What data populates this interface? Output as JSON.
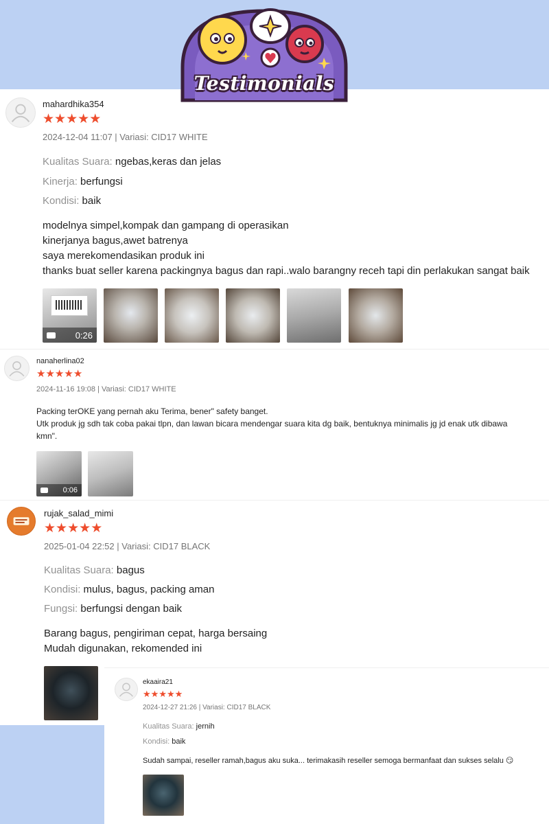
{
  "header": {
    "title": "Testimonials"
  },
  "colors": {
    "page_bg": "#bcd1f3",
    "star": "#ee4d2d",
    "logo_purple": "#7a5bbf",
    "logo_red": "#d93a4f",
    "logo_yellow": "#ffd84d"
  },
  "reviews": [
    {
      "username": "mahardhika354",
      "stars": 5,
      "meta": "2024-12-04 11:07 | Variasi: CID17 WHITE",
      "attributes": [
        {
          "key": "Kualitas Suara:",
          "value": "ngebas,keras dan jelas"
        },
        {
          "key": "Kinerja:",
          "value": "berfungsi"
        },
        {
          "key": "Kondisi:",
          "value": "baik"
        }
      ],
      "body": "modelnya simpel,kompak dan gampang di operasikan\nkinerjanya bagus,awet batrenya\nsaya merekomendasikan produk ini\nthanks buat seller karena packingnya bagus dan rapi..walo barangny receh tapi din perlakukan sangat baik",
      "video_duration": "0:26",
      "media_count": 6
    },
    {
      "username": "nanaherlina02",
      "stars": 5,
      "meta": "2024-11-16 19:08 | Variasi: CID17 WHITE",
      "body": "Packing terOKE yang pernah aku Terima, bener\" safety banget.\nUtk produk jg sdh tak coba pakai tlpn, dan lawan bicara mendengar suara kita dg baik, bentuknya minimalis jg jd enak utk dibawa\nkmn\".",
      "video_duration": "0:06",
      "media_count": 2
    },
    {
      "username": "rujak_salad_mimi",
      "stars": 5,
      "meta": "2025-01-04 22:52 | Variasi: CID17 BLACK",
      "attributes": [
        {
          "key": "Kualitas Suara:",
          "value": "bagus"
        },
        {
          "key": "Kondisi:",
          "value": "mulus, bagus, packing aman"
        },
        {
          "key": "Fungsi:",
          "value": "berfungsi dengan baik"
        }
      ],
      "body": "Barang bagus, pengiriman cepat, harga bersaing\nMudah digunakan, rekomended ini",
      "media_count": 1
    },
    {
      "username": "ekaaira21",
      "stars": 5,
      "meta": "2024-12-27 21:26 | Variasi: CID17 BLACK",
      "attributes": [
        {
          "key": "Kualitas Suara:",
          "value": "jernih"
        },
        {
          "key": "Kondisi:",
          "value": "baik"
        }
      ],
      "body": "Sudah sampai, reseller ramah,bagus aku suka... terimakasih reseller semoga bermanfaat dan sukses selalu 😏",
      "media_count": 1
    }
  ]
}
